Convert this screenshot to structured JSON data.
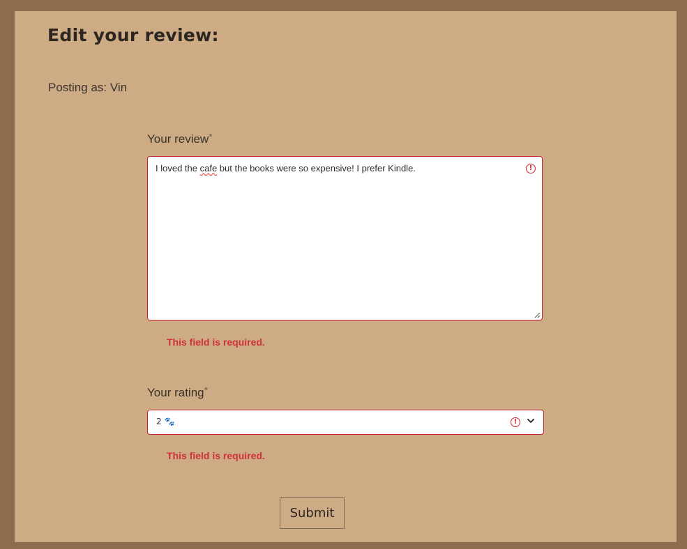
{
  "header": {
    "title": "Edit your review:"
  },
  "posting": {
    "text": "Posting as: Vin"
  },
  "review_field": {
    "label": "Your review",
    "required_mark": "*",
    "value_before": "I loved the ",
    "value_misspelled": "cafe",
    "value_after": " but the books were so expensive! I prefer Kindle.",
    "error": "This field is required.",
    "warn_icon": "!"
  },
  "rating_field": {
    "label": "Your rating",
    "required_mark": "*",
    "selected_number": "2",
    "selected_icon": "🐾",
    "error": "This field is required.",
    "warn_icon": "!"
  },
  "form": {
    "submit_label": "Submit"
  },
  "colors": {
    "outer_background": "#8d6b4d",
    "page_background": "#cdab84",
    "error_red": "#d0303a",
    "input_border_error": "#c8232c"
  }
}
